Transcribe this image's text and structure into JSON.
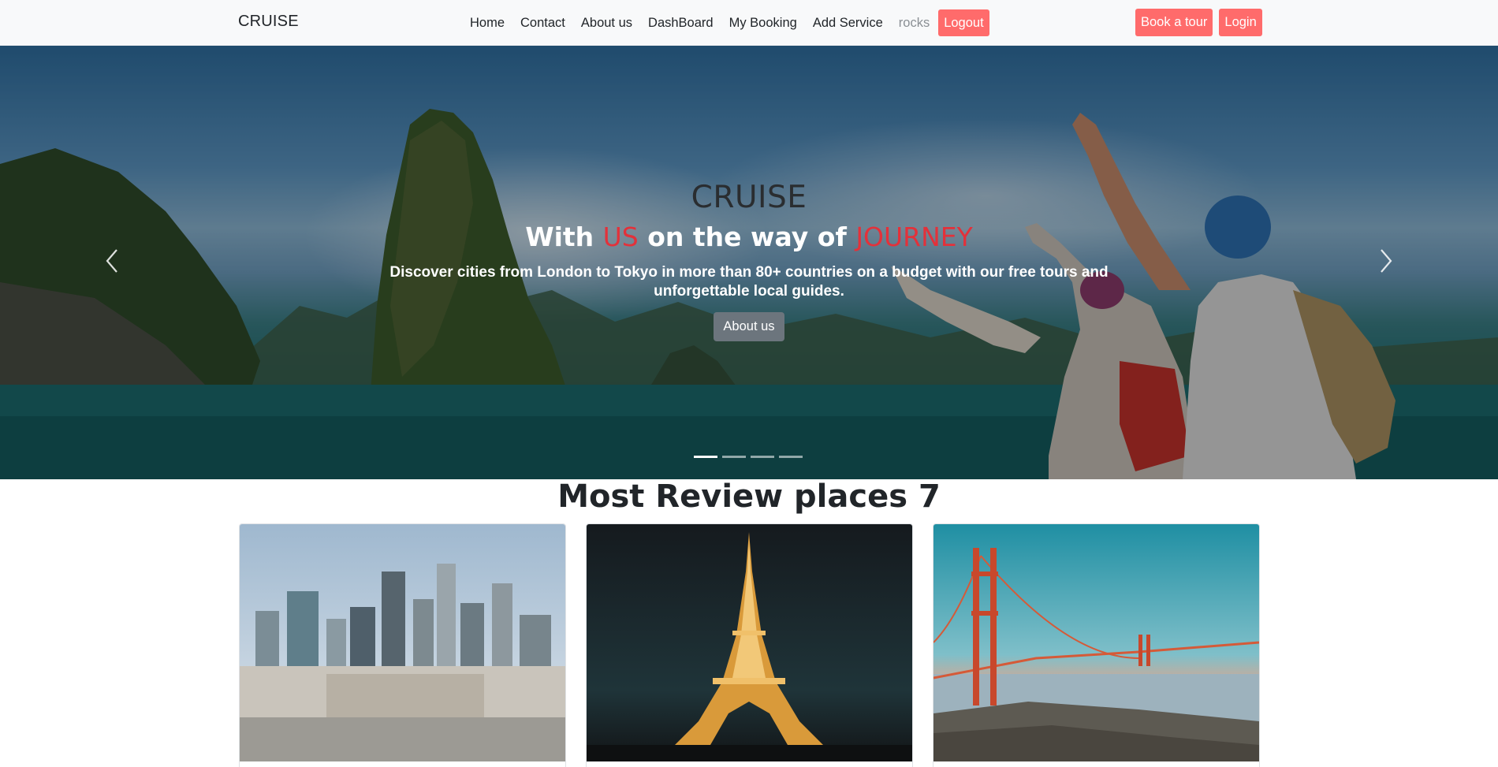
{
  "navbar": {
    "brand": "CRUISE",
    "links": [
      "Home",
      "Contact",
      "About us",
      "DashBoard",
      "My Booking",
      "Add Service"
    ],
    "username": "rocks",
    "logout_label": "Logout",
    "book_tour_label": "Book a tour",
    "login_label": "Login"
  },
  "hero": {
    "title": "CRUISE",
    "subtitle_parts": [
      "With ",
      "US",
      " on the way of ",
      "JOURNEY"
    ],
    "description": "Discover cities from London to Tokyo in more than 80+ countries on a budget with our free tours and unforgettable local guides.",
    "button_label": "About us",
    "slide_count": 4,
    "active_slide": 1
  },
  "section": {
    "title": "Most Review places 7"
  },
  "cards": [
    {
      "image": "city-skyline"
    },
    {
      "image": "eiffel-tower"
    },
    {
      "image": "golden-gate-bridge"
    }
  ],
  "colors": {
    "accent": "#ff6b6b",
    "highlight_red": "#e3313a",
    "hero_button": "#6c757d"
  }
}
